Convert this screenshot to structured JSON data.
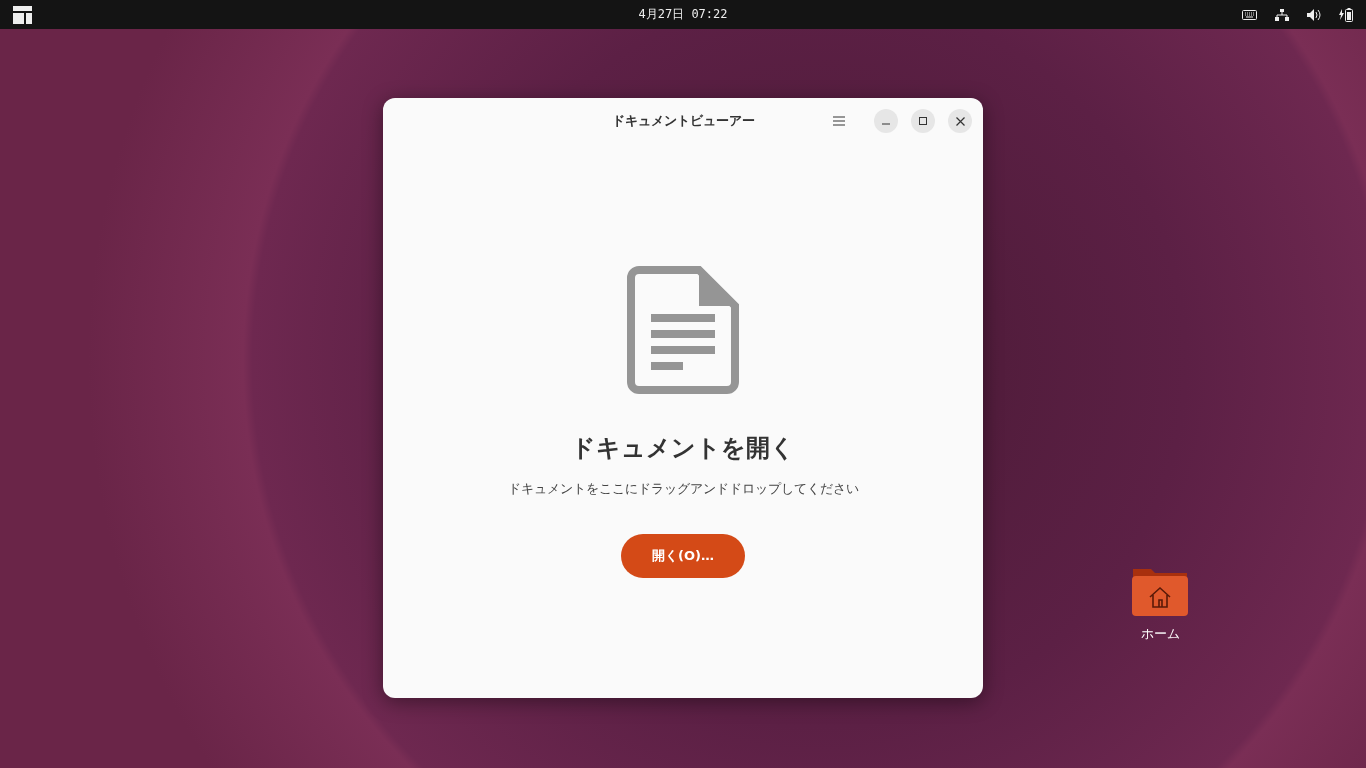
{
  "top_bar": {
    "clock": "4月27日 07:22"
  },
  "window": {
    "title": "ドキュメントビューアー",
    "heading": "ドキュメントを開く",
    "hint": "ドキュメントをここにドラッグアンドドロップしてください",
    "open_button": "開く(O)…"
  },
  "desktop_icons": [
    {
      "label": "ホーム"
    }
  ]
}
